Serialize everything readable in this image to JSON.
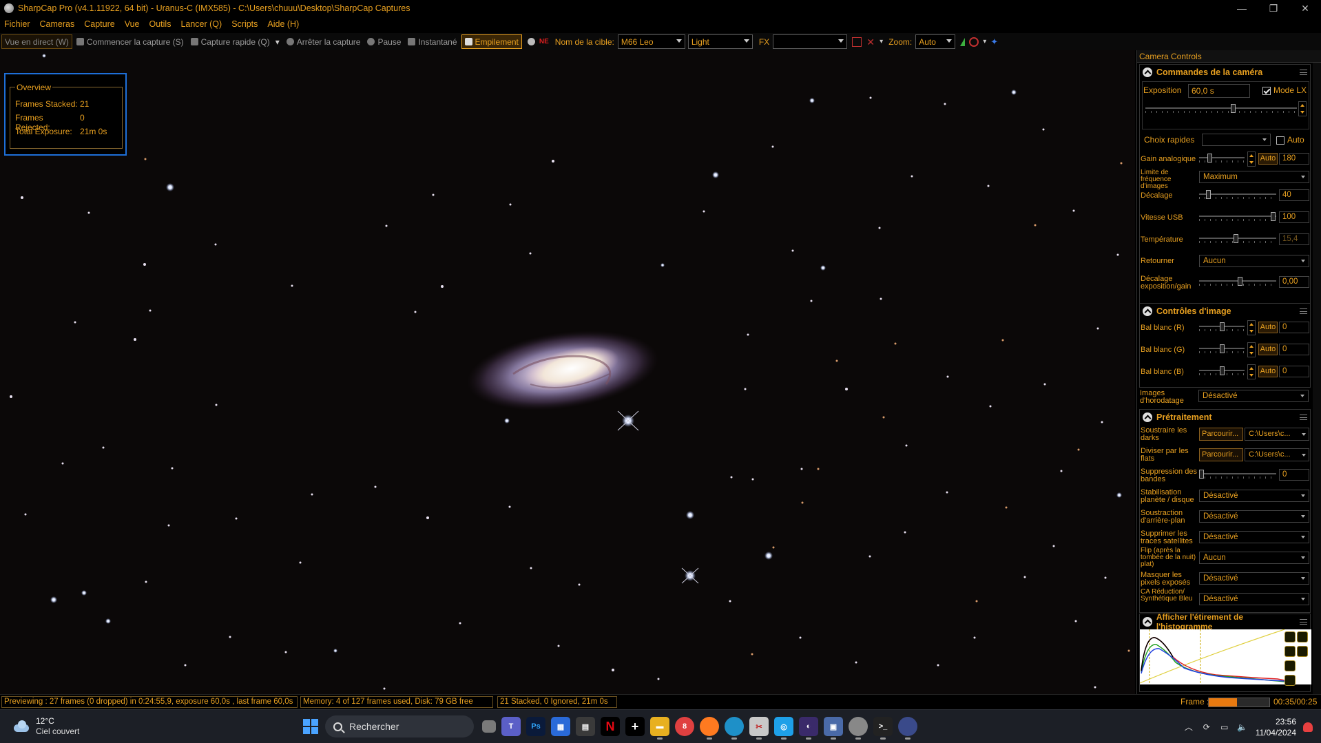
{
  "window": {
    "title": "SharpCap Pro (v4.1.11922, 64 bit) - Uranus-C (IMX585) - C:\\Users\\chuuu\\Desktop\\SharpCap Captures",
    "minimize": "—",
    "maximize": "❐",
    "close": "✕"
  },
  "menu": [
    "Fichier",
    "Cameras",
    "Capture",
    "Vue",
    "Outils",
    "Lancer (Q)",
    "Scripts",
    "Aide (H)"
  ],
  "toolbar": {
    "live_view": "Vue en direct (W)",
    "start_capture": "Commencer la capture (S)",
    "quick_capture": "Capture rapide (Q)",
    "stop_capture": "Arrêter la capture",
    "pause": "Pause",
    "snapshot": "Instantané",
    "stacking": "Empilement",
    "target_label": "Nom de la cible:",
    "target_value": "M66 Leo",
    "frame_type": "Light",
    "fx_label": "FX",
    "fx_value": "",
    "zoom_label": "Zoom:",
    "zoom_value": "Auto"
  },
  "overview": {
    "title": "Overview",
    "frames_stacked_label": "Frames Stacked:",
    "frames_stacked_value": "21",
    "frames_rejected_label": "Frames Rejected:",
    "frames_rejected_value": "0",
    "total_exposure_label": "Total Exposure:",
    "total_exposure_value": "21m 0s"
  },
  "panel": {
    "header": "Camera Controls",
    "camera": {
      "title": "Commandes de la caméra",
      "exposure_label": "Exposition",
      "exposure_value": "60,0 s",
      "lx_mode_label": "Mode LX",
      "lx_mode_checked": true,
      "quick_choice_label": "Choix rapides",
      "quick_choice_value": "",
      "auto_label": "Auto",
      "gain_label": "Gain analogique",
      "gain_auto": "Auto",
      "gain_value": "180",
      "framerate_label": "Limite de fréquence d'images",
      "framerate_value": "Maximum",
      "offset_label": "Décalage",
      "offset_value": "40",
      "usb_label": "Vitesse USB",
      "usb_value": "100",
      "temp_label": "Température",
      "temp_value": "15,4",
      "flip_label": "Retourner",
      "flip_value": "Aucun",
      "expgain_label": "Décalage exposition/gain",
      "expgain_value": "0,00"
    },
    "image": {
      "title": "Contrôles d'image",
      "wb_r_label": "Bal blanc (R)",
      "wb_r_value": "0",
      "wb_g_label": "Bal blanc (G)",
      "wb_g_value": "0",
      "wb_b_label": "Bal blanc (B)",
      "wb_b_value": "0",
      "auto": "Auto",
      "timestamp_label": "Images d'horodatage",
      "timestamp_value": "Désactivé"
    },
    "preproc": {
      "title": "Prétraitement",
      "darks_label": "Soustraire les darks",
      "browse": "Parcourir...",
      "darks_path": "C:\\Users\\c...",
      "flats_label": "Diviser par les flats",
      "flats_path": "C:\\Users\\c...",
      "banding_label": "Suppression des bandes",
      "banding_value": "0",
      "stab_label": "Stabilisation planète / disque",
      "stab_value": "Désactivé",
      "bgsub_label": "Soustraction d'arrière-plan",
      "bgsub_value": "Désactivé",
      "sat_label": "Supprimer les traces satellites",
      "sat_value": "Désactivé",
      "flip_label": "Flip (après la tombée de la nuit) plat)",
      "flip_value": "Aucun",
      "mask_label": "Masquer les pixels exposés",
      "mask_value": "Désactivé",
      "ca_label": "CA Réduction/ Synthétique Bleu",
      "ca_value": "Désactivé"
    },
    "histogram": {
      "title": "Afficher l'étirement de l'histogramme"
    }
  },
  "status": {
    "preview": "Previewing : 27 frames (0 dropped) in 0:24:55,9, exposure 60,0s , last frame 60,0s",
    "memory": "Memory: 4 of 127 frames used, Disk: 79 GB free",
    "stacked": "21 Stacked, 0 Ignored, 21m 0s",
    "frame_label": "Frame :",
    "frame_progress": 0.47,
    "frame_time": "00:35/00:25"
  },
  "taskbar": {
    "temperature": "12°C",
    "condition": "Ciel couvert",
    "search_placeholder": "Rechercher",
    "time": "23:56",
    "date": "11/04/2024"
  },
  "colors": {
    "accent": "#e8a020",
    "highlight_border": "#1e6fd8",
    "taskbar_bg": "#1c1f26"
  }
}
